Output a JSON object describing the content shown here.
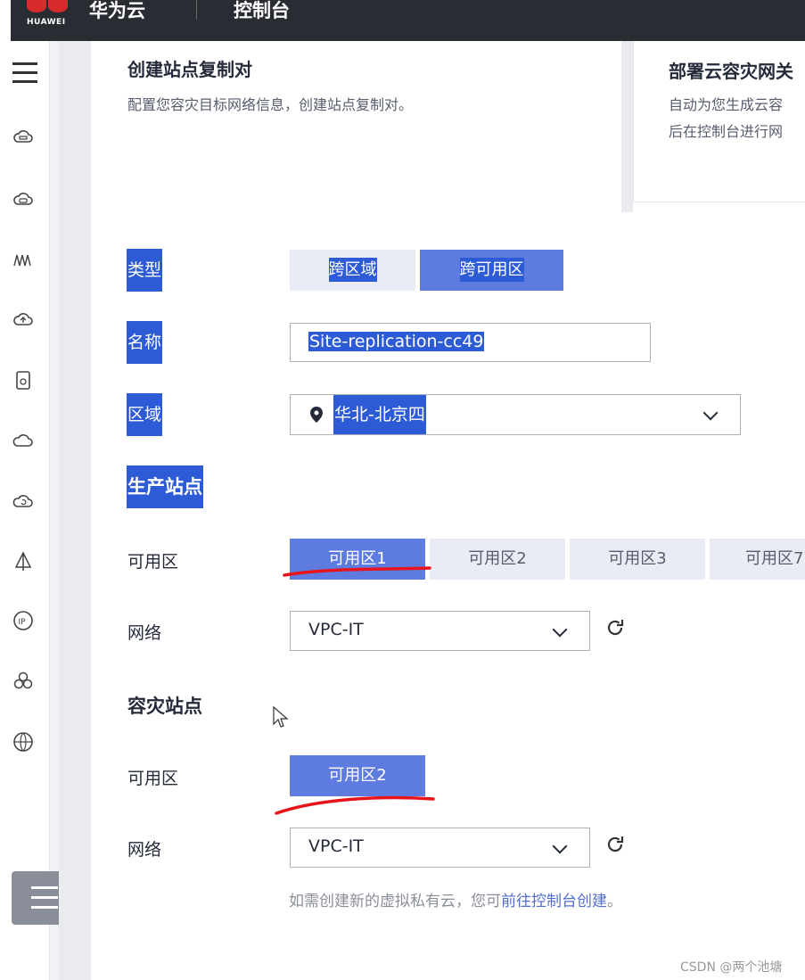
{
  "topbar": {
    "brand": "HUAWEI",
    "title": "华为云",
    "console": "控制台"
  },
  "sidebar": {
    "icons": [
      "menu-icon",
      "cloud-server-icon",
      "cloud-disk-icon",
      "waveform-icon",
      "cloud-upload-icon",
      "storage-device-icon",
      "cloud-icon",
      "cloud-refresh-icon",
      "sail-icon",
      "ip-icon",
      "cluster-icon",
      "globe-icon"
    ],
    "bottom_button": "list-menu-icon"
  },
  "left_card": {
    "title": "创建站点复制对",
    "desc": "配置您容灾目标网络信息，创建站点复制对。"
  },
  "right_card": {
    "title": "部署云容灾网关",
    "desc_line1": "自动为您生成云容",
    "desc_line2": "后在控制台进行网"
  },
  "form": {
    "type_label": "类型",
    "type_options": [
      "跨区域",
      "跨可用区"
    ],
    "type_selected": "跨可用区",
    "name_label": "名称",
    "name_value": "Site-replication-cc49",
    "region_label": "区域",
    "region_value": "华北-北京四",
    "production": {
      "title": "生产站点",
      "az_label": "可用区",
      "az_options": [
        "可用区1",
        "可用区2",
        "可用区3",
        "可用区7"
      ],
      "az_selected": "可用区1",
      "network_label": "网络",
      "network_value": "VPC-IT"
    },
    "dr": {
      "title": "容灾站点",
      "az_label": "可用区",
      "az_value": "可用区2",
      "network_label": "网络",
      "network_value": "VPC-IT"
    },
    "note_prefix": "如需创建新的虚拟私有云，您可",
    "note_link": "前往控制台创建",
    "note_suffix": "。"
  },
  "watermark": "CSDN @两个池塘",
  "colors": {
    "primary": "#5e7ce0",
    "selection": "#2d5bd6",
    "annotation": "#e8141c"
  }
}
